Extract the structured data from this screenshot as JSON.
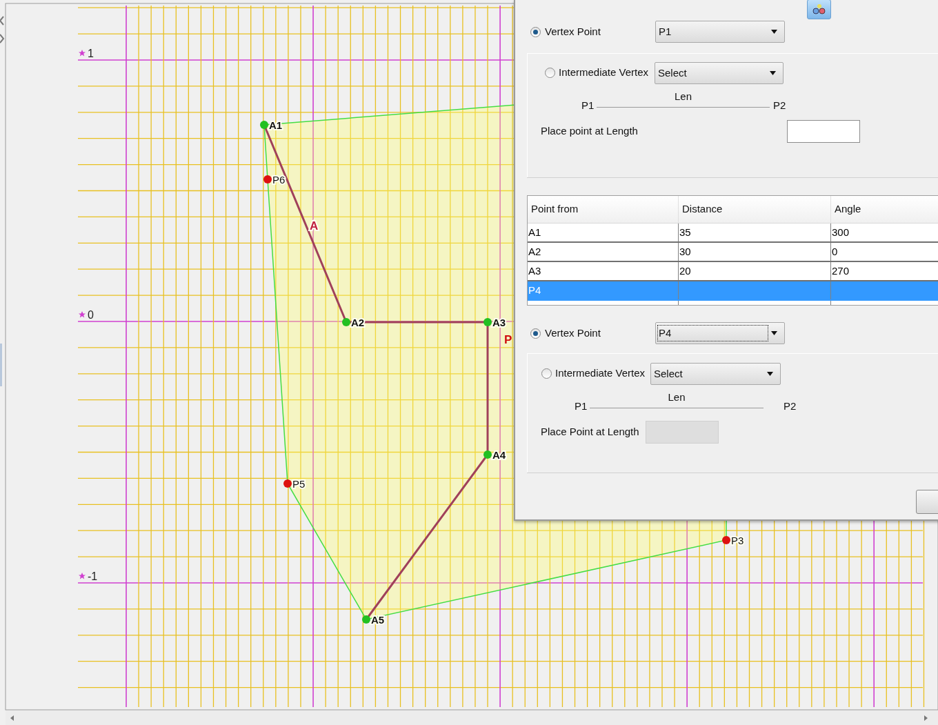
{
  "canvas": {
    "axis_labels": [
      {
        "text": "1"
      },
      {
        "text": "0"
      },
      {
        "text": "-1"
      }
    ],
    "points": [
      {
        "label": "A1",
        "kind": "vertex"
      },
      {
        "label": "P6",
        "kind": "offset"
      },
      {
        "label": "A2",
        "kind": "vertex"
      },
      {
        "label": "A3",
        "kind": "vertex"
      },
      {
        "label": "A4",
        "kind": "vertex"
      },
      {
        "label": "P5",
        "kind": "offset"
      },
      {
        "label": "A5",
        "kind": "vertex"
      },
      {
        "label": "P3",
        "kind": "offset"
      }
    ],
    "edge_label": "A",
    "clipped_label": "P"
  },
  "dialog": {
    "sections": [
      {
        "vertex_radio": {
          "label": "Vertex Point",
          "selected": true
        },
        "vertex_dropdown": {
          "value": "P1",
          "focused": false
        },
        "intermediate_radio": {
          "label": "Intermediate Vertex",
          "selected": false
        },
        "intermediate_dropdown": {
          "value": "Select"
        },
        "len_label": "Len",
        "start_label": "P1",
        "end_label": "P2",
        "length_label": "Place point at Length",
        "length_field": {
          "disabled": false
        }
      },
      {
        "vertex_radio": {
          "label": "Vertex Point",
          "selected": true
        },
        "vertex_dropdown": {
          "value": "P4",
          "focused": true
        },
        "intermediate_radio": {
          "label": "Intermediate Vertex",
          "selected": false
        },
        "intermediate_dropdown": {
          "value": "Select"
        },
        "len_label": "Len",
        "start_label": "P1",
        "end_label": "P2",
        "length_label": "Place Point at Length",
        "length_field": {
          "disabled": true
        }
      }
    ],
    "table": {
      "columns": [
        "Point from",
        "Distance",
        "Angle"
      ],
      "rows": [
        {
          "cells": [
            "A1",
            "35",
            "300"
          ],
          "selected": false
        },
        {
          "cells": [
            "A2",
            "30",
            "0"
          ],
          "selected": false
        },
        {
          "cells": [
            "A3",
            "20",
            "270"
          ],
          "selected": false
        },
        {
          "cells": [
            "P4"
          ],
          "selected": true
        }
      ]
    }
  }
}
